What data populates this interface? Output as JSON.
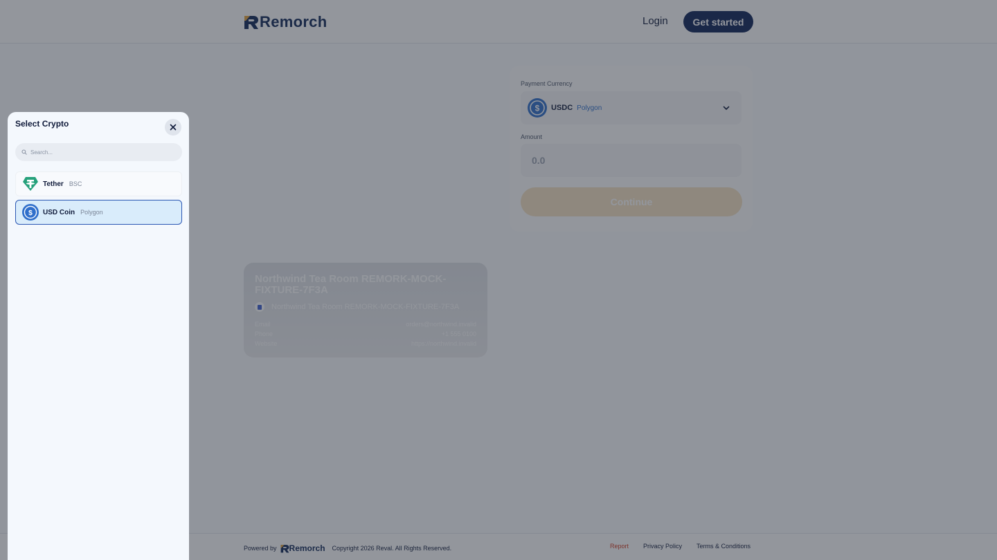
{
  "header": {
    "brand": "Remorch",
    "login_label": "Login",
    "get_started_label": "Get started"
  },
  "payment": {
    "currency_label": "Payment Currency",
    "selected_currency": {
      "code": "USDC",
      "network": "Polygon",
      "icon": "usdc-coin-icon"
    },
    "amount_label": "Amount",
    "amount_placeholder": "0.0",
    "continue_label": "Continue"
  },
  "merchant": {
    "name": "Northwind Tea Room REMORK-MOCK-FIXTURE-7F3A",
    "subtitle": "Northwind Tea Room REMORK-MOCK-FIXTURE-7F3A",
    "rows": [
      {
        "label": "Email",
        "value": "orders@northwind.invalid"
      },
      {
        "label": "Phone",
        "value": "+1 555 0100"
      },
      {
        "label": "Website",
        "value": "https://northwind.invalid"
      }
    ]
  },
  "footer": {
    "powered_by": "Powered by",
    "brand": "Remorch",
    "copyright": "Copyright 2026 Reval. All Rights Reserved.",
    "links": [
      "Report",
      "Privacy Policy",
      "Terms & Conditions"
    ]
  },
  "select_crypto": {
    "title": "Select Crypto",
    "search_placeholder": "Search...",
    "items": [
      {
        "name": "Tether",
        "network": "BSC",
        "icon": "tether-icon",
        "selected": false
      },
      {
        "name": "USD Coin",
        "network": "Polygon",
        "icon": "usdc-coin-icon",
        "selected": true
      }
    ]
  },
  "colors": {
    "brand_navy": "#0d2356",
    "usdc_blue": "#2f6fcb",
    "tether_green": "#26a17b",
    "continue_disabled": "#f6e3c3",
    "report_red": "#d0391f",
    "overlay": "rgba(40,46,58,0.5)"
  }
}
